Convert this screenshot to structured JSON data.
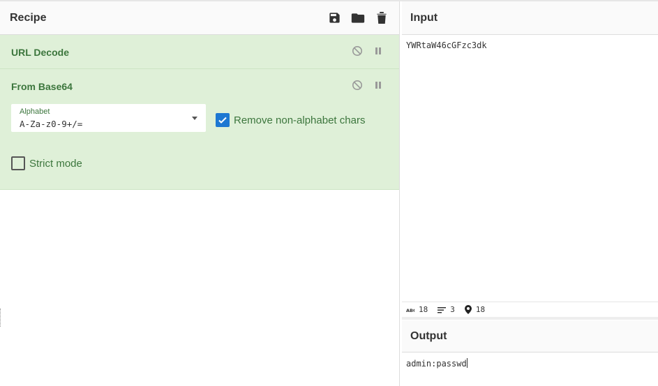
{
  "recipe": {
    "title": "Recipe",
    "icons": [
      "save-icon",
      "folder-icon",
      "trash-icon"
    ],
    "operations": [
      {
        "name": "URL Decode",
        "controls": [
          "disable-icon",
          "pause-icon"
        ]
      },
      {
        "name": "From Base64",
        "controls": [
          "disable-icon",
          "pause-icon"
        ],
        "alphabet": {
          "label": "Alphabet",
          "value": "A-Za-z0-9+/="
        },
        "remove_non_alphabet": {
          "label": "Remove non-alphabet chars",
          "checked": true
        },
        "strict_mode": {
          "label": "Strict mode",
          "checked": false
        }
      }
    ]
  },
  "input": {
    "title": "Input",
    "value": "YWRtaW46cGFzc3dk",
    "status": {
      "length": "18",
      "lines": "3",
      "position": "18"
    }
  },
  "output": {
    "title": "Output",
    "value": "admin:passwd"
  },
  "colors": {
    "accent": "#1e78d2",
    "op_bg": "#dff0d8",
    "op_text": "#3c763d"
  }
}
